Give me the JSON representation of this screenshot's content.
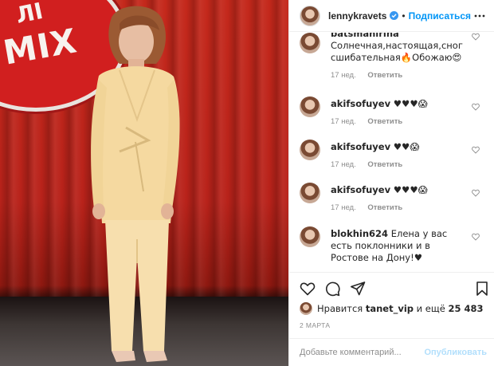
{
  "post": {
    "author": "lennykravets",
    "follow_label": "Подписаться",
    "separator": "•",
    "photo_logo_text": "МІХ",
    "photo_logo_text_top": "ЛІ"
  },
  "comments": [
    {
      "username": "batsmanirina",
      "text": "Солнечная,настоящая,сногсшибательная🔥Обожаю😍",
      "time": "17 нед.",
      "reply_label": "Ответить"
    },
    {
      "username": "akifsofuyev",
      "text": "♥♥♥😱",
      "time": "17 нед.",
      "reply_label": "Ответить"
    },
    {
      "username": "akifsofuyev",
      "text": "♥♥😱",
      "time": "17 нед.",
      "reply_label": "Ответить"
    },
    {
      "username": "akifsofuyev",
      "text": "♥♥♥😱",
      "time": "17 нед.",
      "reply_label": "Ответить"
    },
    {
      "username": "blokhin624",
      "text": "Елена у вас есть поклонники и в Ростове на Дону!♥",
      "time": "",
      "reply_label": ""
    }
  ],
  "likes": {
    "prefix": "Нравится",
    "user": "tanet_vip",
    "connector": "и ещё",
    "count": "25 483"
  },
  "date": "2 МАРТА",
  "add_comment": {
    "placeholder": "Добавьте комментарий...",
    "publish_label": "Опубликовать"
  },
  "colors": {
    "accent": "#0095f6",
    "publish_disabled": "#b2dffc",
    "muted": "#8e8e8e",
    "text": "#262626",
    "curtain": "#c4281b"
  },
  "icons": [
    "verified-icon",
    "more-icon",
    "heart-icon",
    "comment-icon",
    "share-icon",
    "bookmark-icon"
  ]
}
